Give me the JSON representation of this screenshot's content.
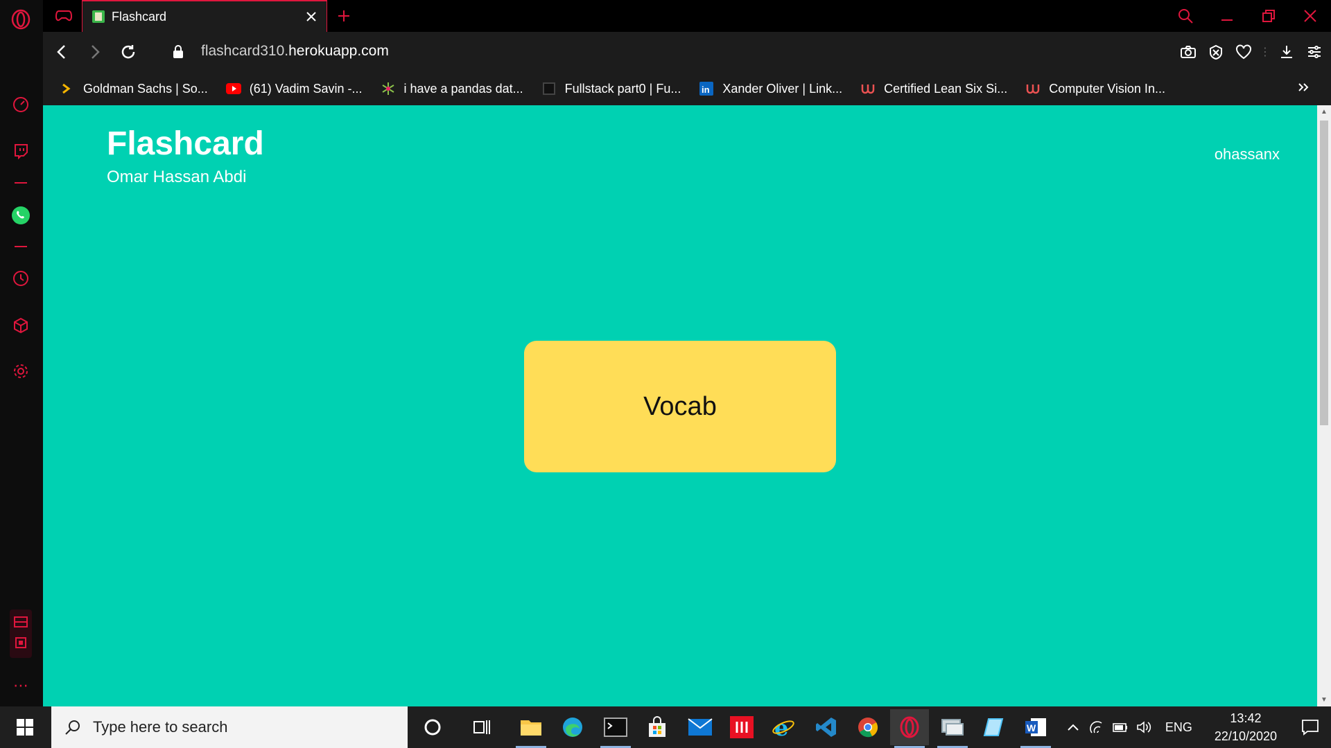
{
  "browser": {
    "tab": {
      "title": "Flashcard",
      "favicon": "flashcard-favicon"
    },
    "url": {
      "prefix": "flashcard310.",
      "host": "herokuapp.com"
    },
    "accent_color": "#e0163d"
  },
  "bookmarks": [
    {
      "label": "Goldman Sachs | So...",
      "icon": "goldman-icon"
    },
    {
      "label": "(61) Vadim Savin -...",
      "icon": "youtube-icon"
    },
    {
      "label": "i have a pandas dat...",
      "icon": "stack-icon"
    },
    {
      "label": "Fullstack part0 | Fu...",
      "icon": "fullstack-icon"
    },
    {
      "label": "Xander Oliver | Link...",
      "icon": "linkedin-icon"
    },
    {
      "label": "Certified Lean Six Si...",
      "icon": "udemy-icon"
    },
    {
      "label": "Computer Vision In...",
      "icon": "udemy-icon"
    }
  ],
  "page": {
    "title": "Flashcard",
    "subtitle": "Omar Hassan Abdi",
    "username": "ohassanx",
    "card_label": "Vocab",
    "background_color": "#00d1b2",
    "card_color": "#ffdd57"
  },
  "taskbar": {
    "search_placeholder": "Type here to search",
    "language": "ENG",
    "time": "13:42",
    "date": "22/10/2020"
  }
}
